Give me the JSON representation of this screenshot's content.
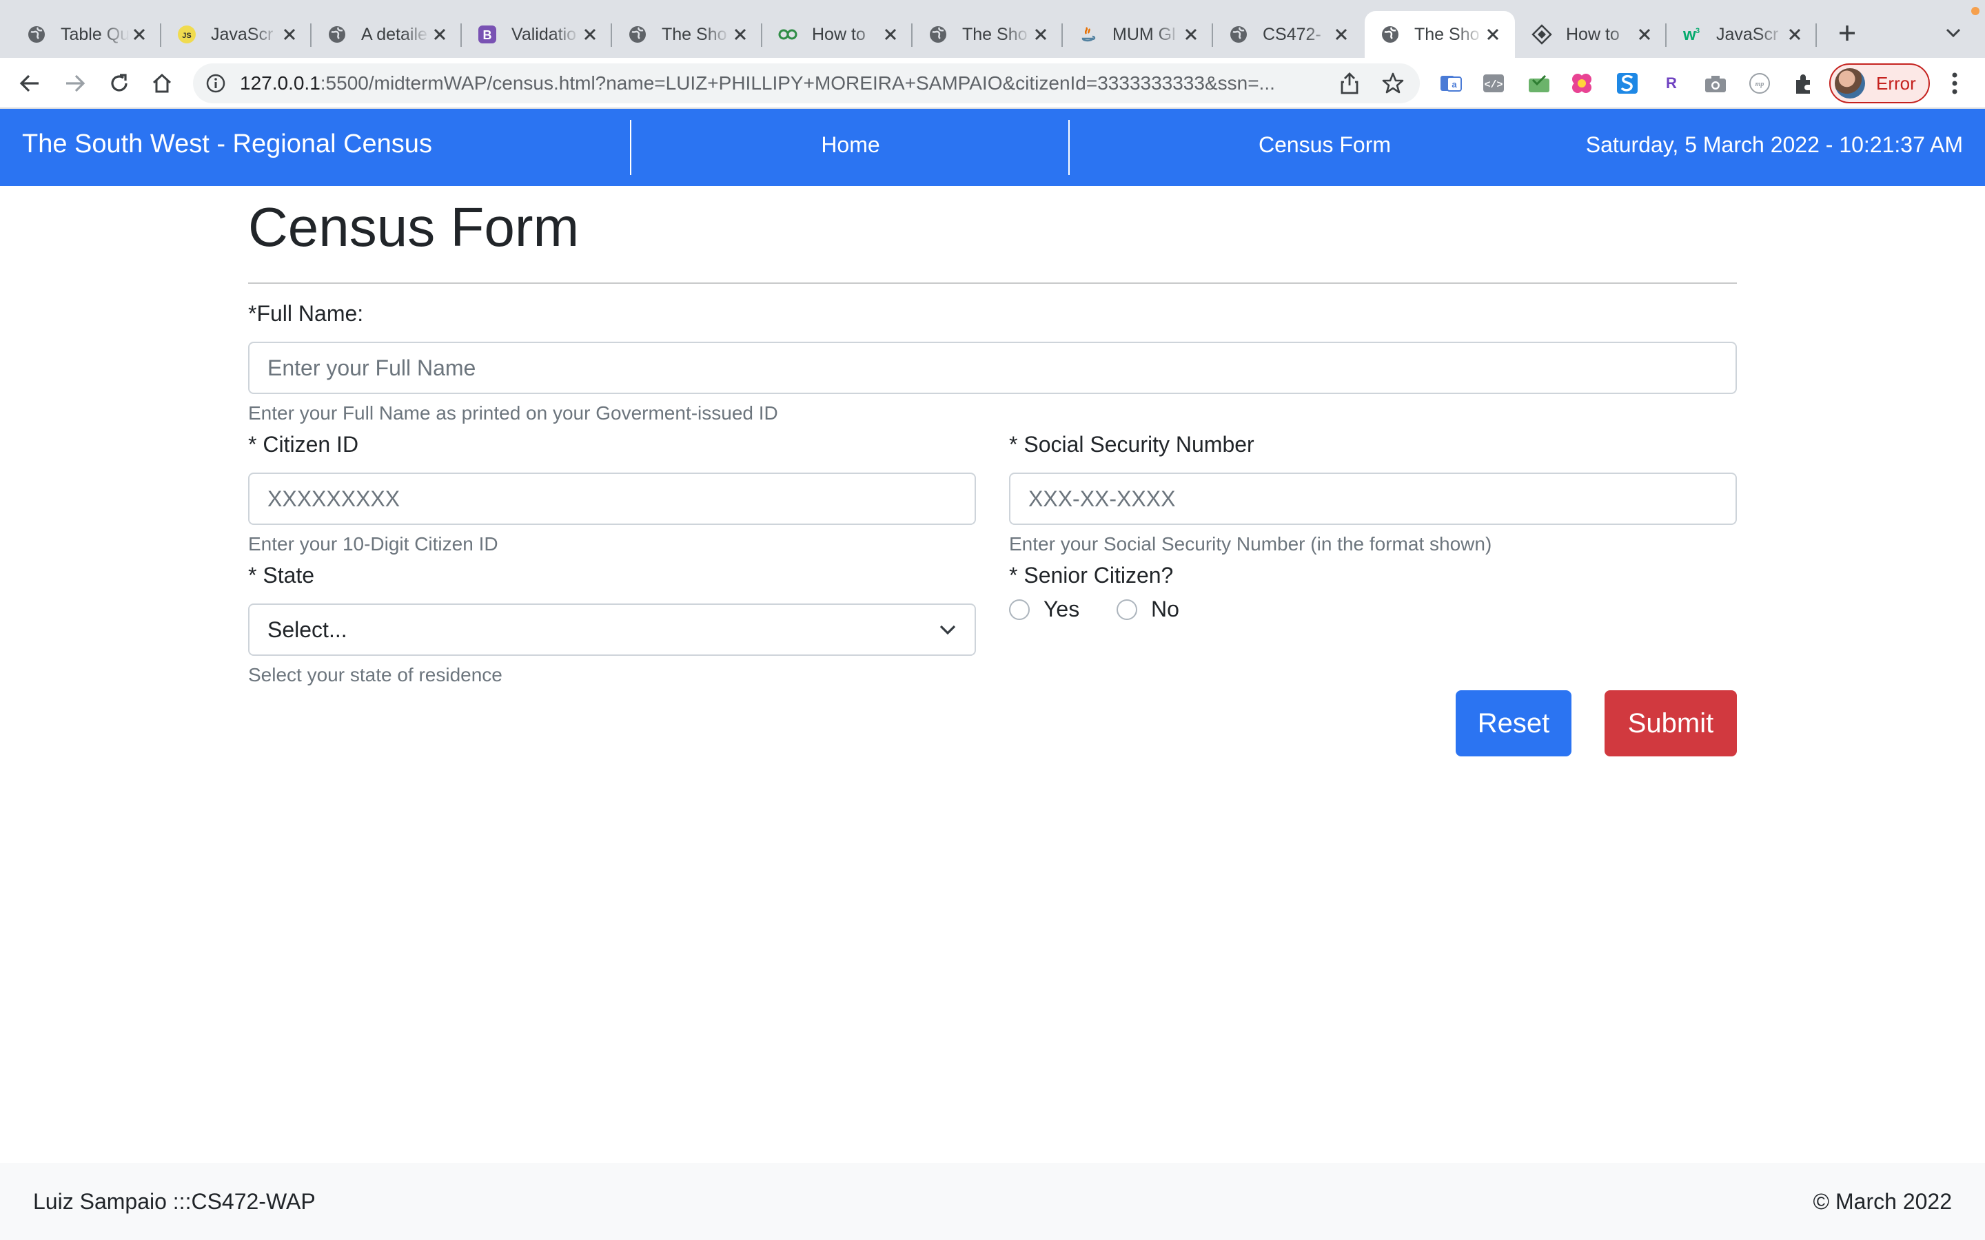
{
  "browser": {
    "tabs": [
      {
        "title": "Table Qu",
        "icon": "globe-icon",
        "active": false
      },
      {
        "title": "JavaScr",
        "icon": "js-icon",
        "active": false
      },
      {
        "title": "A detaile",
        "icon": "globe-icon",
        "active": false
      },
      {
        "title": "Validatio",
        "icon": "bootstrap-icon",
        "active": false
      },
      {
        "title": "The Sho",
        "icon": "globe-icon",
        "active": false
      },
      {
        "title": "How to",
        "icon": "geeks-icon",
        "active": false
      },
      {
        "title": "The Sho",
        "icon": "globe-icon",
        "active": false
      },
      {
        "title": "MUM Gl",
        "icon": "java-icon",
        "active": false
      },
      {
        "title": "CS472-",
        "icon": "globe-icon",
        "active": false
      },
      {
        "title": "The Sho",
        "icon": "globe-icon",
        "active": true
      },
      {
        "title": "How to",
        "icon": "diamond-icon",
        "active": false
      },
      {
        "title": "JavaScr",
        "icon": "w3-icon",
        "active": false
      }
    ],
    "url_host": "127.0.0.1",
    "url_path": ":5500/midtermWAP/census.html?name=LUIZ+PHILLIPY+MOREIRA+SAMPAIO&citizenId=3333333333&ssn=...",
    "profile_status": "Error"
  },
  "navbar": {
    "brand": "The South West - Regional Census",
    "links": [
      "Home",
      "Census Form"
    ],
    "datetime": "Saturday, 5 March 2022 - 10:21:37 AM"
  },
  "form": {
    "title": "Census Form",
    "full_name": {
      "label": "*Full Name:",
      "placeholder": "Enter your Full Name",
      "help": "Enter your Full Name as printed on your Goverment-issued ID"
    },
    "citizen_id": {
      "label": "* Citizen ID",
      "placeholder": "XXXXXXXXX",
      "help": "Enter your 10-Digit Citizen ID"
    },
    "ssn": {
      "label": "* Social Security Number",
      "placeholder": "XXX-XX-XXXX",
      "help": "Enter your Social Security Number (in the format shown)"
    },
    "state": {
      "label": "* State",
      "selected": "Select...",
      "help": "Select your state of residence"
    },
    "senior": {
      "label": "* Senior Citizen?",
      "options": [
        "Yes",
        "No"
      ]
    },
    "reset_label": "Reset",
    "submit_label": "Submit"
  },
  "footer": {
    "left": "Luiz Sampaio :::CS472-WAP",
    "right": "© March 2022"
  },
  "colors": {
    "navbar": "#2b74f2",
    "reset": "#2b74f2",
    "submit": "#d1393f"
  }
}
